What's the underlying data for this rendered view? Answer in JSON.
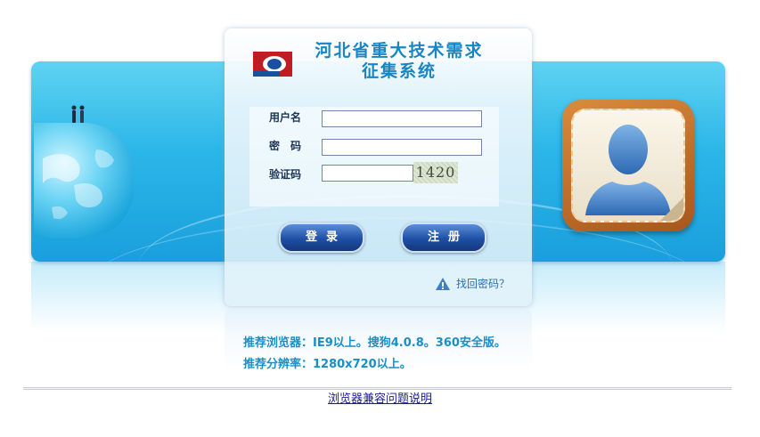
{
  "header": {
    "title_line1": "河北省重大技术需求",
    "title_line2": "征集系统"
  },
  "form": {
    "username_label": "用户名",
    "password_label": "密　码",
    "captcha_label": "验证码",
    "username_value": "",
    "password_value": "",
    "captcha_value": "",
    "captcha_image_text": "1420"
  },
  "buttons": {
    "login": "登录",
    "register": "注册"
  },
  "links": {
    "forgot_password": "找回密码？",
    "browser_compat": "浏览器兼容问题说明"
  },
  "tips": {
    "browser": "推荐浏览器：IE9以上。搜狗4.0.8。360安全版。",
    "resolution": "推荐分辨率：1280x720以上。"
  },
  "decor": {
    "dots": "......"
  },
  "colors": {
    "accent": "#1a85c2",
    "button": "#1f4fa6",
    "banner": "#2bb6e8"
  }
}
